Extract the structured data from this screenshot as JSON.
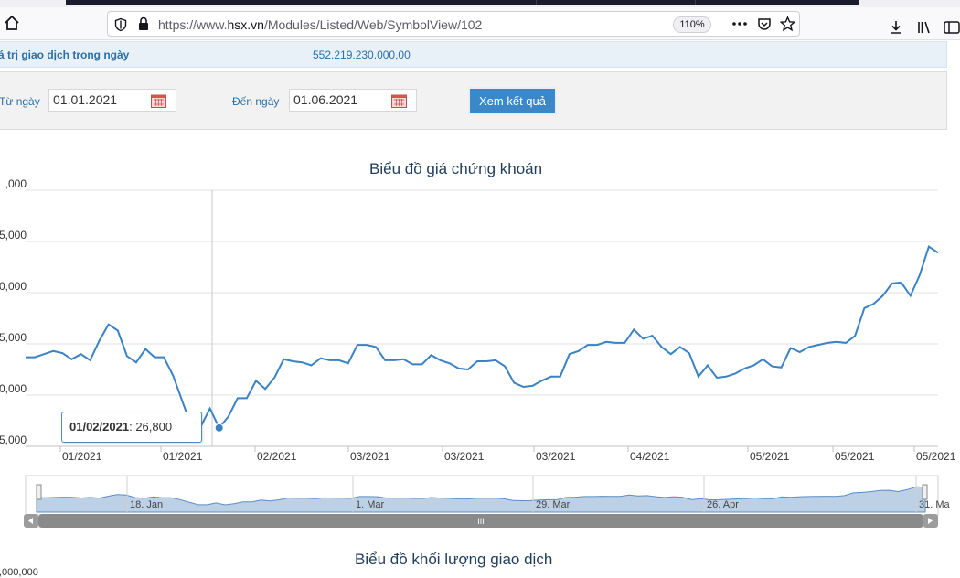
{
  "browser": {
    "url_prefix": "https://www.",
    "url_domain": "hsx.vn",
    "url_path": "/Modules/Listed/Web/SymbolView/102",
    "zoom": "110%"
  },
  "summary": {
    "trade_value_label": "á trị giao dịch trong ngày",
    "trade_value": "552.219.230.000,00"
  },
  "filter": {
    "from_label": "Từ ngày",
    "from_value": "01.01.2021",
    "to_label": "Đến ngày",
    "to_value": "01.06.2021",
    "submit_label": "Xem kết quả"
  },
  "price_chart": {
    "title": "Biểu đồ giá chứng khoán",
    "y_tick_labels": [
      ",000",
      "5,000",
      "0,000",
      "5,000",
      "0,000",
      "5,000"
    ],
    "x_tick_labels": [
      "01/2021",
      "01/2021",
      "02/2021",
      "03/2021",
      "03/2021",
      "03/2021",
      "04/2021",
      "05/2021",
      "05/2021",
      "05/2021"
    ],
    "tooltip_date": "01/02/2021",
    "tooltip_value": "26,800",
    "navigator_labels": [
      "18. Jan",
      "1. Mar",
      "29. Mar",
      "26. Apr",
      "31. Ma"
    ],
    "scrollbar_grip": "III"
  },
  "volume_chart": {
    "title": "Biểu đồ khối lượng giao dịch",
    "first_tick": ",000,000"
  },
  "chart_data": {
    "type": "line",
    "title": "Biểu đồ giá chứng khoán",
    "ylim": [
      25000,
      50000
    ],
    "highlight": {
      "x": "01/02/2021",
      "y": 26800
    },
    "series": [
      {
        "values": [
          33700,
          33700,
          34000,
          34300,
          34100,
          33500,
          34000,
          33400,
          35300,
          36900,
          36300,
          33800,
          33200,
          34500,
          33700,
          33700,
          31900,
          29400,
          26900,
          26900,
          28700,
          26800,
          27900,
          29700,
          29700,
          31400,
          30600,
          31700,
          33500,
          33300,
          33200,
          32900,
          33600,
          33400,
          33400,
          33100,
          34900,
          34900,
          34700,
          33400,
          33400,
          33500,
          33000,
          33000,
          33900,
          33400,
          33100,
          32600,
          32500,
          33300,
          33300,
          33400,
          32800,
          31200,
          30800,
          30900,
          31400,
          31800,
          31800,
          34000,
          34300,
          34900,
          34900,
          35200,
          35100,
          35100,
          36400,
          35500,
          35800,
          34700,
          34000,
          34700,
          34100,
          31800,
          32900,
          31700,
          31800,
          32100,
          32600,
          32900,
          33500,
          32800,
          32700,
          34600,
          34200,
          34700,
          34900,
          35100,
          35200,
          35100,
          35800,
          38500,
          38900,
          39700,
          40900,
          41000,
          39700,
          41700,
          44500,
          43900
        ]
      }
    ]
  }
}
